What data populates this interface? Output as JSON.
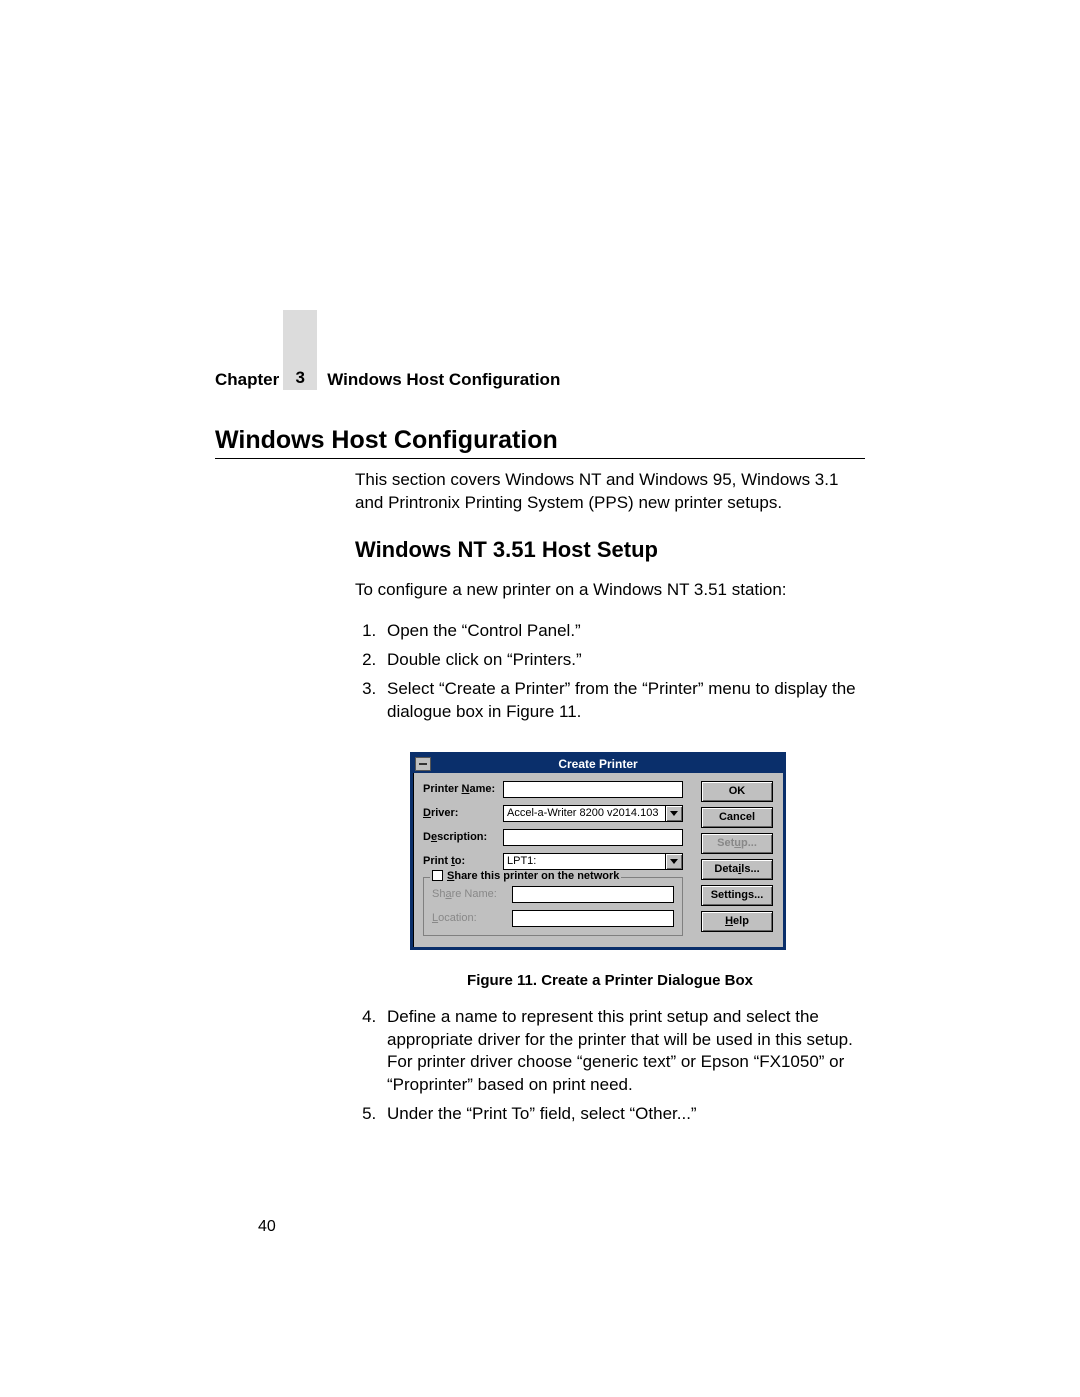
{
  "header": {
    "chapter_label": "Chapter",
    "chapter_number": "3",
    "chapter_title": "Windows Host Configuration"
  },
  "section": {
    "title": "Windows Host Configuration",
    "intro": "This section covers Windows NT and Windows 95, Windows 3.1 and Printronix Printing System (PPS) new printer setups."
  },
  "subsection": {
    "title": "Windows NT 3.51 Host Setup",
    "lead": "To configure a new printer on a Windows NT 3.51 station:",
    "steps_first": [
      "Open the “Control Panel.”",
      "Double click on “Printers.”",
      "Select “Create a Printer” from the “Printer” menu to display the dialogue box in Figure 11."
    ],
    "steps_second_start": 4,
    "steps_second": [
      "Define a name to represent this print setup and select the appropriate driver for the printer that will be used in this setup. For printer driver choose “generic text” or Epson “FX1050” or “Proprinter” based on print need.",
      "Under the “Print To” field, select “Other...”"
    ]
  },
  "dialog": {
    "title": "Create Printer",
    "labels": {
      "printer_name": "Printer Name:",
      "driver": "Driver:",
      "description": "Description:",
      "print_to": "Print to:",
      "share_legend": "Share this printer on the network",
      "share_name": "Share Name:",
      "location": "Location:"
    },
    "values": {
      "printer_name": "",
      "driver": "Accel-a-Writer 8200 v2014.103",
      "description": "",
      "print_to": "LPT1:",
      "share_name": "",
      "location": ""
    },
    "buttons": {
      "ok": "OK",
      "cancel": "Cancel",
      "setup": "Setup...",
      "details": "Details...",
      "settings": "Settings...",
      "help": "Help"
    }
  },
  "figure_caption": "Figure 11. Create a Printer Dialogue Box",
  "page_number": "40"
}
